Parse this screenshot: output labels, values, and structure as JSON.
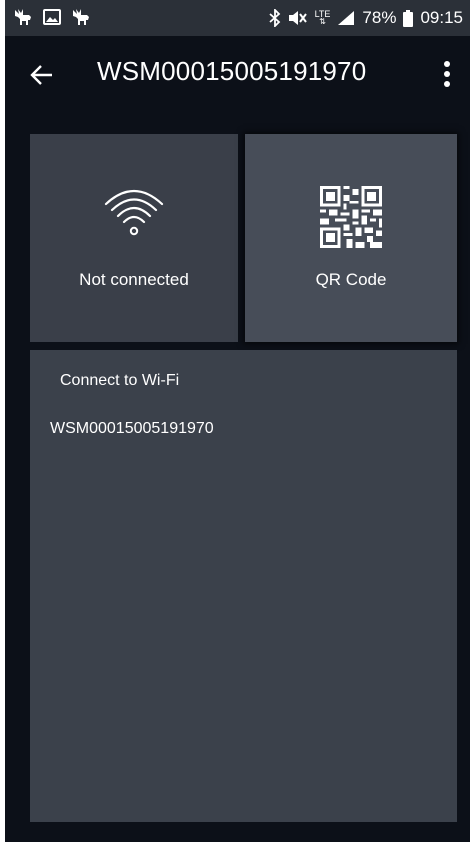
{
  "status_bar": {
    "left_icons": [
      "moose-notification-icon",
      "image-notification-icon",
      "moose-notification-icon"
    ],
    "right_icons": [
      "bluetooth-icon",
      "mute-icon",
      "lte-icon",
      "signal-icon"
    ],
    "lte_label": "LTE",
    "battery": "78%",
    "time": "09:15"
  },
  "app_bar": {
    "title": "WSM00015005191970"
  },
  "tiles": {
    "wifi": {
      "label": "Not connected",
      "icon": "wifi-icon"
    },
    "qr": {
      "label": "QR Code",
      "icon": "qr-code-icon"
    }
  },
  "panel": {
    "heading": "Connect to Wi-Fi",
    "networks": [
      "WSM00015005191970"
    ]
  },
  "colors": {
    "background": "#0c1018",
    "status_bar": "#2b3038",
    "tile_wifi": "#3a3f49",
    "tile_qr": "#474d58",
    "panel": "#3b414b",
    "text": "#ffffff"
  }
}
